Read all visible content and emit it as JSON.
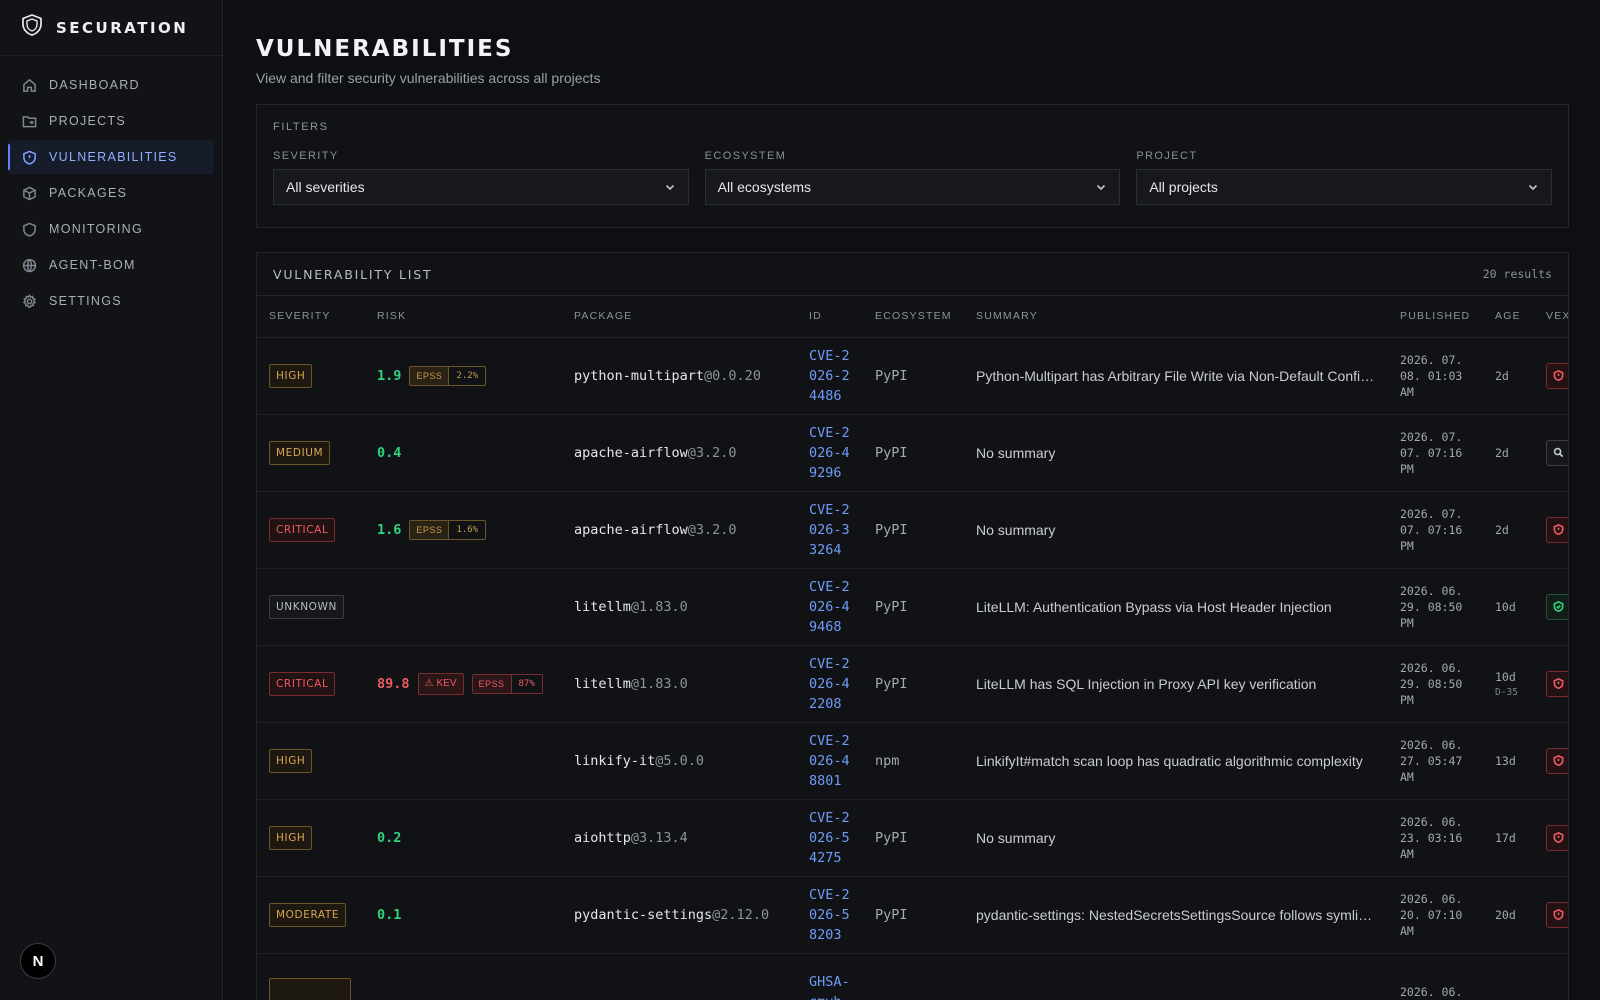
{
  "brand": {
    "name": "SECURATION"
  },
  "sidebar": {
    "items": [
      {
        "label": "DASHBOARD",
        "icon": "home-icon",
        "active": false
      },
      {
        "label": "PROJECTS",
        "icon": "folder-icon",
        "active": false
      },
      {
        "label": "VULNERABILITIES",
        "icon": "shield-icon",
        "active": true
      },
      {
        "label": "PACKAGES",
        "icon": "package-icon",
        "active": false
      },
      {
        "label": "MONITORING",
        "icon": "shield-outline-icon",
        "active": false
      },
      {
        "label": "AGENT-BOM",
        "icon": "globe-icon",
        "active": false
      },
      {
        "label": "SETTINGS",
        "icon": "gear-icon",
        "active": false
      }
    ],
    "avatar_letter": "N"
  },
  "header": {
    "title": "VULNERABILITIES",
    "subtitle": "View and filter security vulnerabilities across all projects"
  },
  "filters": {
    "section_label": "FILTERS",
    "severity": {
      "label": "SEVERITY",
      "value": "All severities"
    },
    "ecosystem": {
      "label": "ECOSYSTEM",
      "value": "All ecosystems"
    },
    "project": {
      "label": "PROJECT",
      "value": "All projects"
    }
  },
  "list": {
    "title": "VULNERABILITY LIST",
    "count": "20 results",
    "columns": [
      "SEVERITY",
      "RISK",
      "PACKAGE",
      "ID",
      "ECOSYSTEM",
      "SUMMARY",
      "PUBLISHED",
      "AGE",
      "VEX"
    ],
    "rows": [
      {
        "severity": "HIGH",
        "sev_class": "high",
        "risk": "1.9",
        "kev": "",
        "epss_label": "EPSS",
        "epss": "2.2%",
        "pkg_name": "python-multipart",
        "pkg_ver": "@0.0.20",
        "id": "CVE-2026-24486",
        "ecosystem": "PyPI",
        "summary": "Python-Multipart has Arbitrary File Write via Non-Default Configuration",
        "published": "2026. 07. 08. 01:03 AM",
        "age": "2d",
        "age_note": "",
        "vex": "red"
      },
      {
        "severity": "MEDIUM",
        "sev_class": "medium",
        "risk": "0.4",
        "kev": "",
        "epss_label": "",
        "epss": "",
        "pkg_name": "apache-airflow",
        "pkg_ver": "@3.2.0",
        "id": "CVE-2026-49296",
        "ecosystem": "PyPI",
        "summary": "No summary",
        "published": "2026. 07. 07. 07:16 PM",
        "age": "2d",
        "age_note": "",
        "vex": "grey"
      },
      {
        "severity": "CRITICAL",
        "sev_class": "critical",
        "risk": "1.6",
        "kev": "",
        "epss_label": "EPSS",
        "epss": "1.6%",
        "pkg_name": "apache-airflow",
        "pkg_ver": "@3.2.0",
        "id": "CVE-2026-33264",
        "ecosystem": "PyPI",
        "summary": "No summary",
        "published": "2026. 07. 07. 07:16 PM",
        "age": "2d",
        "age_note": "",
        "vex": "red"
      },
      {
        "severity": "UNKNOWN",
        "sev_class": "unknown",
        "risk": "",
        "kev": "",
        "epss_label": "",
        "epss": "",
        "pkg_name": "litellm",
        "pkg_ver": "@1.83.0",
        "id": "CVE-2026-49468",
        "ecosystem": "PyPI",
        "summary": "LiteLLM: Authentication Bypass via Host Header Injection",
        "published": "2026. 06. 29. 08:50 PM",
        "age": "10d",
        "age_note": "",
        "vex": "green"
      },
      {
        "severity": "CRITICAL",
        "sev_class": "critical",
        "risk": "89.8",
        "kev": "KEV",
        "epss_label": "EPSS",
        "epss": "87%",
        "pkg_name": "litellm",
        "pkg_ver": "@1.83.0",
        "id": "CVE-2026-42208",
        "ecosystem": "PyPI",
        "summary": "LiteLLM has SQL Injection in Proxy API key verification",
        "published": "2026. 06. 29. 08:50 PM",
        "age": "10d",
        "age_note": "D-35",
        "vex": "red"
      },
      {
        "severity": "HIGH",
        "sev_class": "high",
        "risk": "",
        "kev": "",
        "epss_label": "",
        "epss": "",
        "pkg_name": "linkify-it",
        "pkg_ver": "@5.0.0",
        "id": "CVE-2026-48801",
        "ecosystem": "npm",
        "summary": "LinkifyIt#match scan loop has quadratic algorithmic complexity",
        "published": "2026. 06. 27. 05:47 AM",
        "age": "13d",
        "age_note": "",
        "vex": "red"
      },
      {
        "severity": "HIGH",
        "sev_class": "high",
        "risk": "0.2",
        "kev": "",
        "epss_label": "",
        "epss": "",
        "pkg_name": "aiohttp",
        "pkg_ver": "@3.13.4",
        "id": "CVE-2026-54275",
        "ecosystem": "PyPI",
        "summary": "No summary",
        "published": "2026. 06. 23. 03:16 AM",
        "age": "17d",
        "age_note": "",
        "vex": "red"
      },
      {
        "severity": "MODERATE",
        "sev_class": "moderate",
        "risk": "0.1",
        "kev": "",
        "epss_label": "",
        "epss": "",
        "pkg_name": "pydantic-settings",
        "pkg_ver": "@2.12.0",
        "id": "CVE-2026-58203",
        "ecosystem": "PyPI",
        "summary": "pydantic-settings: NestedSecretsSettingsSource follows symlinks",
        "published": "2026. 06. 20. 07:10 AM",
        "age": "20d",
        "age_note": "",
        "vex": "red"
      },
      {
        "severity": "",
        "sev_class": "moderate",
        "risk": "",
        "kev": "",
        "epss_label": "",
        "epss": "",
        "pkg_name": "",
        "pkg_ver": "",
        "id": "GHSA-cmvh-",
        "ecosystem": "",
        "summary": "",
        "published": "2026. 06.",
        "age": "",
        "age_note": "",
        "vex": ""
      }
    ]
  },
  "colors": {
    "accent": "#5d86f5",
    "critical": "#ef5b62",
    "high": "#d9a655",
    "risk_low": "#2fd37e",
    "link": "#6f9cf6"
  }
}
